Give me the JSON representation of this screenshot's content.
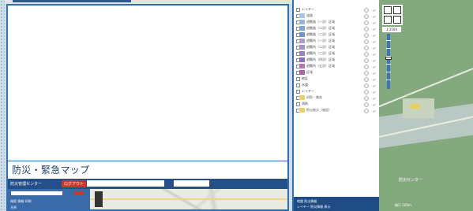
{
  "app": {
    "title": "防災・緊急マップ",
    "subtitle": "",
    "user_name": "防災管理センター",
    "header_button": "ログアウト",
    "mini_tools_1": "検索   情報   印刷",
    "mini_tools_2": "凡例"
  },
  "layers": [
    {
      "label": "レイヤー",
      "color": "#ffffff",
      "group": true
    },
    {
      "label": "道路",
      "color": "#a3c8f0"
    },
    {
      "label": "避難路（一次）区域",
      "color": "#8fb7e6"
    },
    {
      "label": "避難路（二次）区域",
      "color": "#7aa4dd"
    },
    {
      "label": "避難路（三次）区域",
      "color": "#6b95d0"
    },
    {
      "label": "避難所（一次）区域",
      "color": "#b09ad8"
    },
    {
      "label": "避難所（二次）区域",
      "color": "#a78bd3"
    },
    {
      "label": "避難所（三次）区域",
      "color": "#9a7ccb"
    },
    {
      "label": "避難所（四次）区域",
      "color": "#8d6dc2"
    },
    {
      "label": "避難所（五次）区域",
      "color": "#c070b8"
    },
    {
      "label": "区域",
      "color": "#ad5faa"
    },
    {
      "label": "地区",
      "color": "#ffffff",
      "group": true
    },
    {
      "label": "水道",
      "color": "#ffffff",
      "group": true
    },
    {
      "label": "レイヤー",
      "color": "#ffffff",
      "group": true
    },
    {
      "label": "消防・救急",
      "color": "#e9d35e"
    },
    {
      "label": "消防",
      "color": "#ffffff",
      "group": true
    },
    {
      "label": "防災拠点（施設）",
      "color": "#e9d35e"
    }
  ],
  "layer_footer": {
    "line1": "地図 防災情報",
    "line2": "レイヤー 防災情報  表示"
  },
  "map": {
    "zoom_value": "1:2500",
    "place_label": "防災センター",
    "scale_label": "縮尺  200m"
  }
}
